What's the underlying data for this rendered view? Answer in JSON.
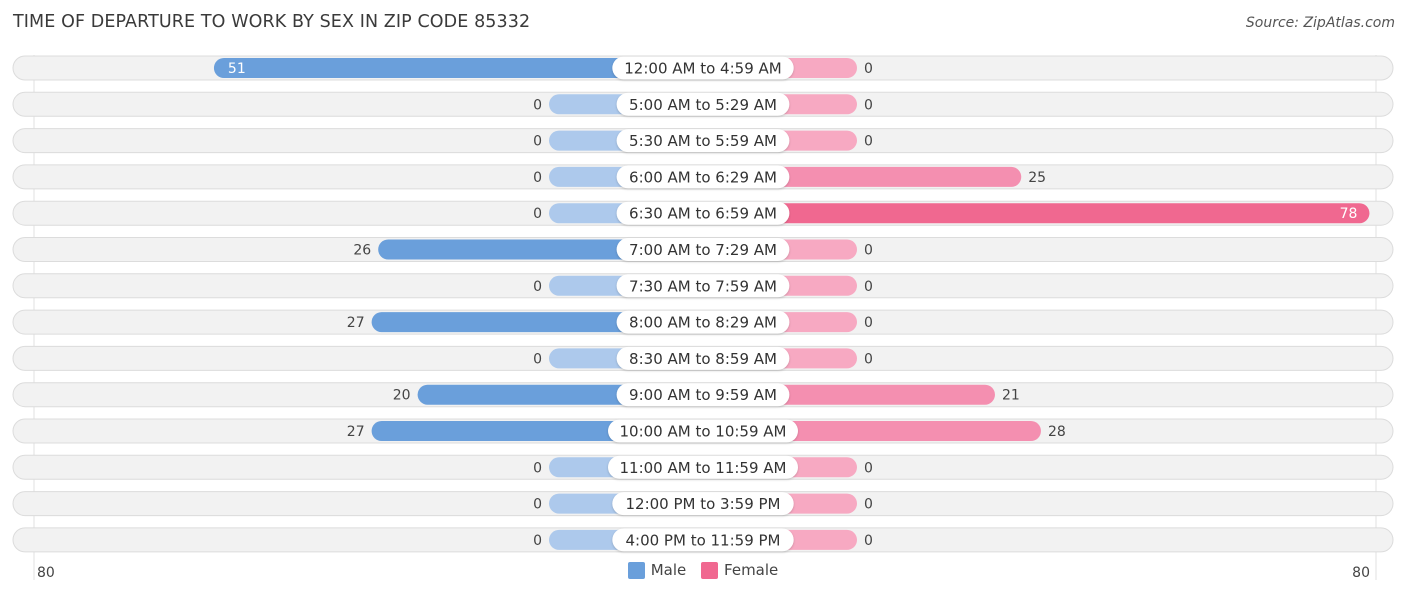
{
  "chart_data": {
    "type": "bar",
    "orientation": "horizontal-diverging",
    "title": "TIME OF DEPARTURE TO WORK BY SEX IN ZIP CODE 85332",
    "source": "Source: ZipAtlas.com",
    "categories": [
      "12:00 AM to 4:59 AM",
      "5:00 AM to 5:29 AM",
      "5:30 AM to 5:59 AM",
      "6:00 AM to 6:29 AM",
      "6:30 AM to 6:59 AM",
      "7:00 AM to 7:29 AM",
      "7:30 AM to 7:59 AM",
      "8:00 AM to 8:29 AM",
      "8:30 AM to 8:59 AM",
      "9:00 AM to 9:59 AM",
      "10:00 AM to 10:59 AM",
      "11:00 AM to 11:59 AM",
      "12:00 PM to 3:59 PM",
      "4:00 PM to 11:59 PM"
    ],
    "series": [
      {
        "name": "Male",
        "color": "#6a9fdb",
        "color_light": "#adc9ec",
        "side": "left",
        "values": [
          51,
          0,
          0,
          0,
          0,
          26,
          0,
          27,
          0,
          20,
          27,
          0,
          0,
          0
        ]
      },
      {
        "name": "Female",
        "color": "#f06890",
        "color_light": "#f7a9c2",
        "side": "right",
        "values": [
          0,
          0,
          0,
          25,
          78,
          0,
          0,
          0,
          0,
          21,
          28,
          0,
          0,
          0
        ]
      }
    ],
    "axis": {
      "left_max_label": "80",
      "right_max_label": "80",
      "range": [
        0,
        80
      ]
    },
    "legend": {
      "position": "bottom-center",
      "entries": [
        "Male",
        "Female"
      ]
    }
  }
}
